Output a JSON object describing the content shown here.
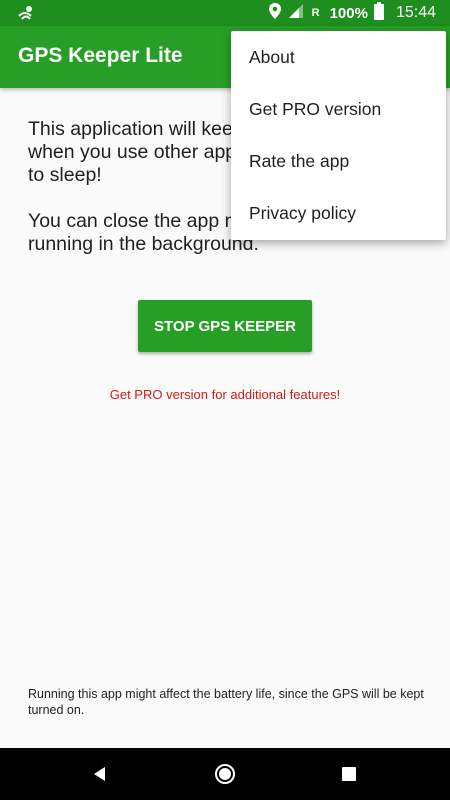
{
  "status_bar": {
    "battery_percent": "100%",
    "network_indicator": "R",
    "time": "15:44",
    "icons": [
      "gps-keeper-notification-icon",
      "location-pin-icon",
      "signal-icon",
      "battery-icon"
    ]
  },
  "app_bar": {
    "title": "GPS Keeper Lite",
    "color": "#279f27"
  },
  "main": {
    "description_1": "This application will keep the GPS active when you use other apps or if the phone goes to sleep!",
    "description_2": "You can close the app now. It will keep running in the background.",
    "stop_button_label": "STOP GPS KEEPER",
    "pro_link": "Get PRO version for additional features!",
    "battery_note": "Running this app might affect the battery life, since the GPS will be kept turned on."
  },
  "menu": {
    "items": [
      {
        "label": "About"
      },
      {
        "label": "Get PRO version"
      },
      {
        "label": "Rate the app"
      },
      {
        "label": "Privacy policy"
      }
    ]
  },
  "nav_bar": {
    "icons": [
      "back-icon",
      "home-icon",
      "recent-apps-icon"
    ]
  },
  "colors": {
    "status_bar": "#1e8e1e",
    "accent": "#279f27",
    "pro_text": "#d11a1a"
  }
}
